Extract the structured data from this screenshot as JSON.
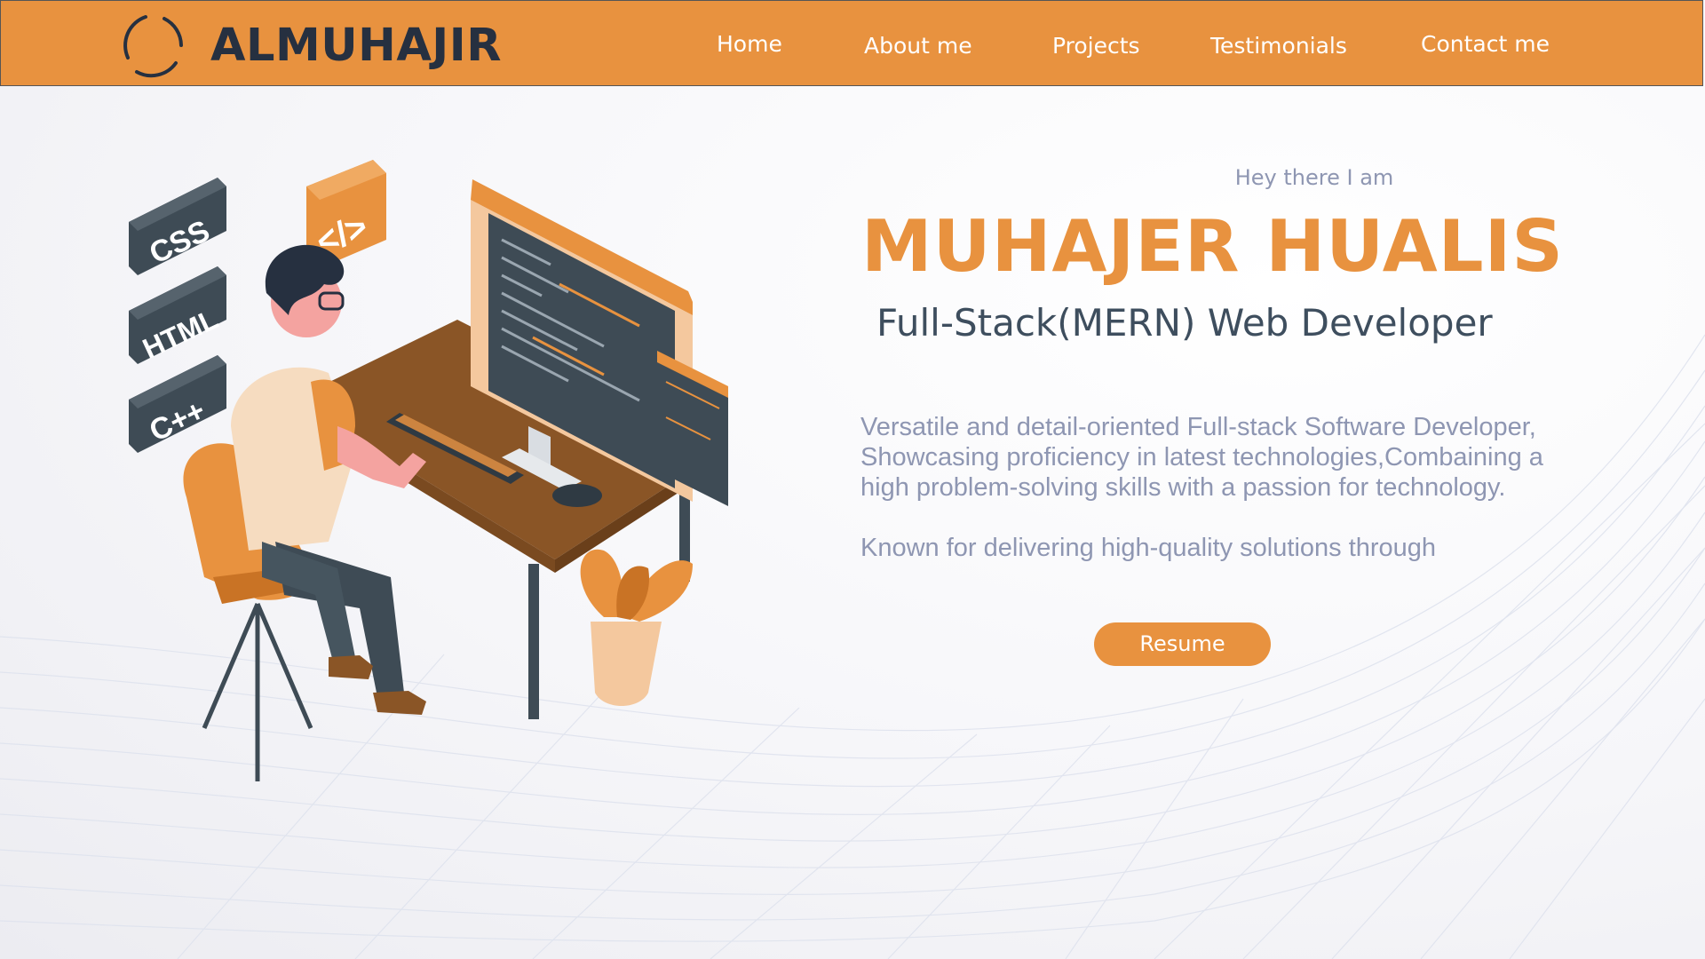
{
  "nav": {
    "brand": "ALMUHAJIR",
    "links": [
      "Home",
      "About me",
      "Projects",
      "Testimonials",
      "Contact me"
    ]
  },
  "illustration": {
    "badges": [
      "CSS",
      "HTML",
      "C++"
    ],
    "code_bubble": "</>"
  },
  "hero": {
    "greeting": "Hey there I am",
    "name": "MUHAJER HUALIS",
    "role": "Full-Stack(MERN) Web Developer",
    "description": "Versatile and detail-oriented Full-stack Software Developer, Showcasing proficiency in latest technologies,Combaining a high problem-solving skills with a passion for technology.",
    "description2": "Known for delivering high-quality solutions through",
    "resume_label": "Resume"
  },
  "colors": {
    "accent": "#e8923f",
    "dark": "#263040",
    "muted_text": "#8e96b2",
    "slate": "#3e4e5e"
  },
  "icons": [
    "logo-ring-icon",
    "css-badge-icon",
    "html-badge-icon",
    "cpp-badge-icon",
    "code-bubble-icon",
    "potted-plant-icon"
  ]
}
